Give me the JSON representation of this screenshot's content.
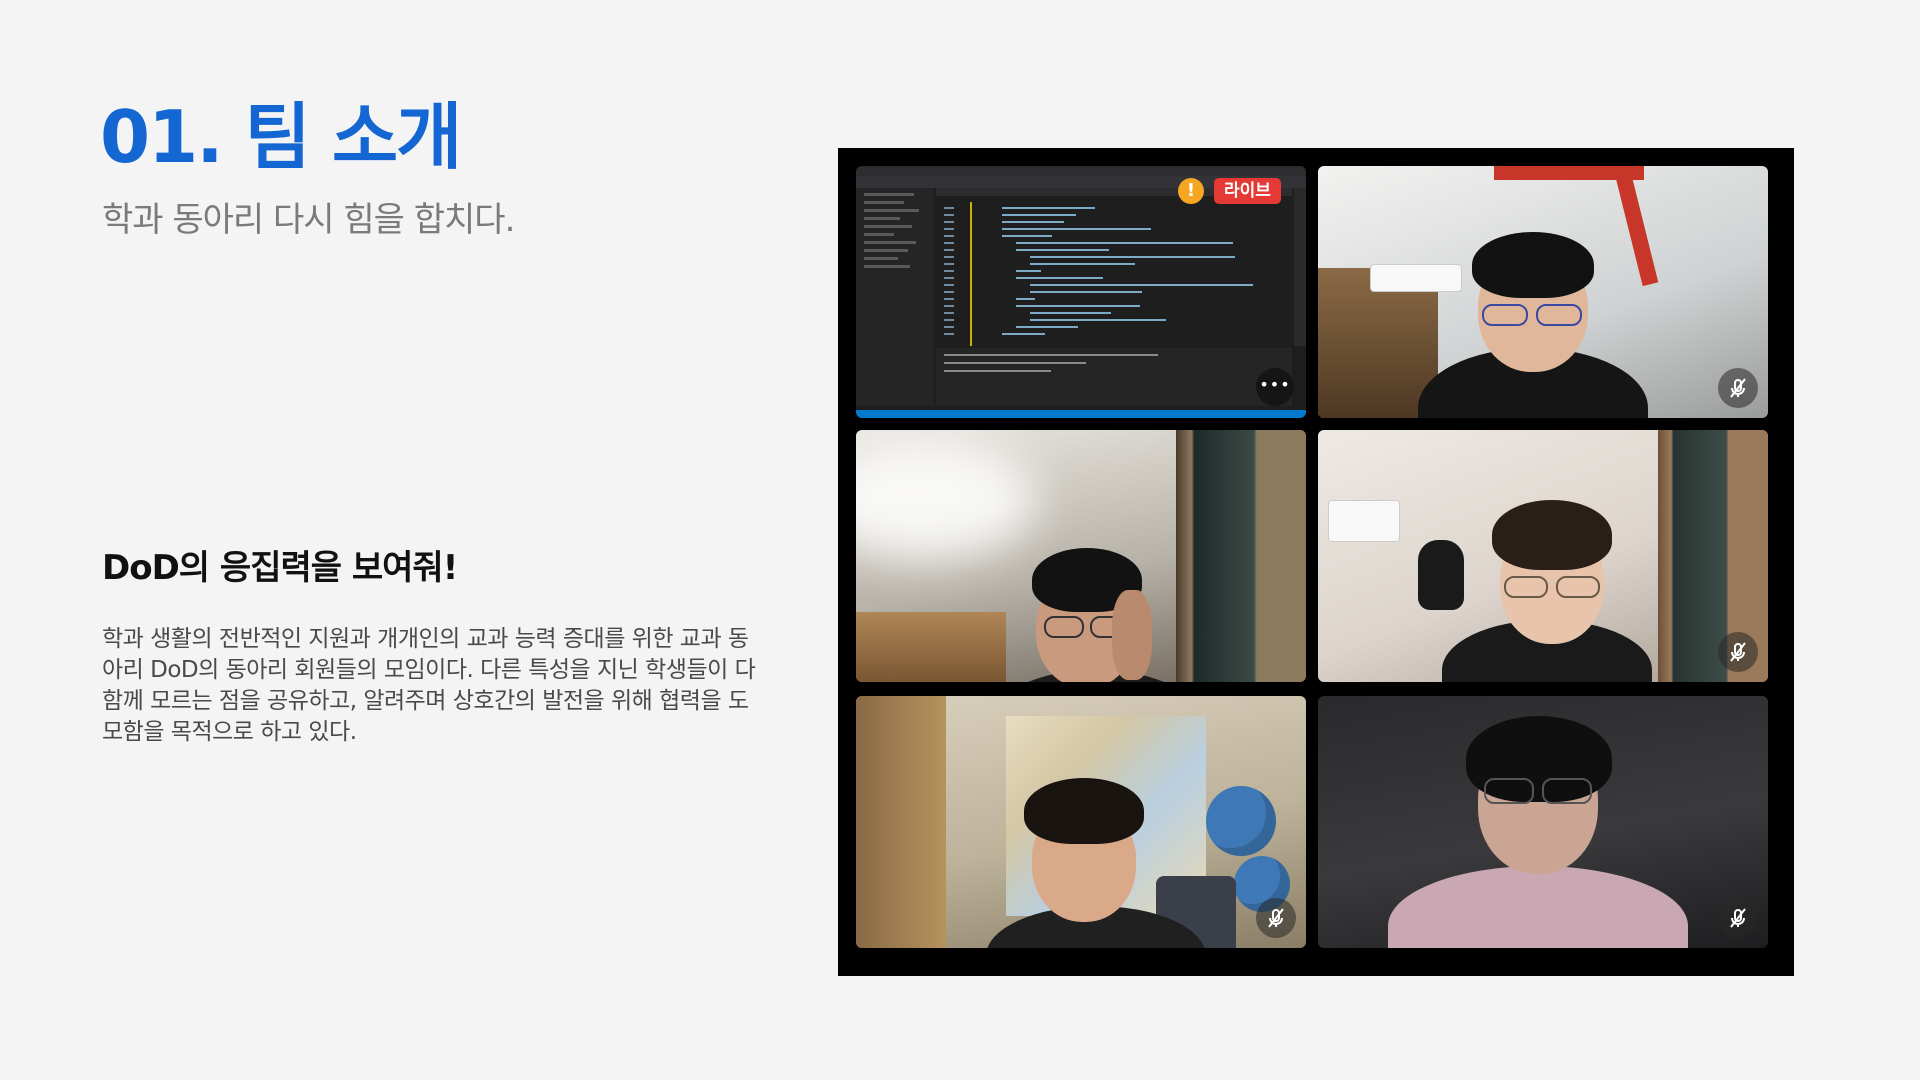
{
  "slide": {
    "title": "01. 팀 소개",
    "subtitle": "학과 동아리 다시 힘을 합치다.",
    "section_heading": "DoD의 응집력을 보여줘!",
    "description": "학과 생활의 전반적인 지원과 개개인의 교과 능력 증대를 위한 교과 동아리 DoD의 동아리 회원들의 모임이다. 다른 특성을 지닌 학생들이 다 함께 모르는 점을 공유하고, 알려주며 상호간의 발전을 위해 협력을 도모함을 목적으로 하고 있다.",
    "accent_color": "#1466d2"
  },
  "video_call": {
    "live_badge": "라이브",
    "warning_icon": "!",
    "more_icon": "•••",
    "tiles": [
      {
        "type": "screen-share",
        "content": "code-editor",
        "has_more_button": true
      },
      {
        "type": "camera",
        "muted": true
      },
      {
        "type": "camera",
        "muted": false
      },
      {
        "type": "camera",
        "muted": true
      },
      {
        "type": "camera",
        "muted": true
      },
      {
        "type": "camera",
        "muted": true
      }
    ]
  }
}
